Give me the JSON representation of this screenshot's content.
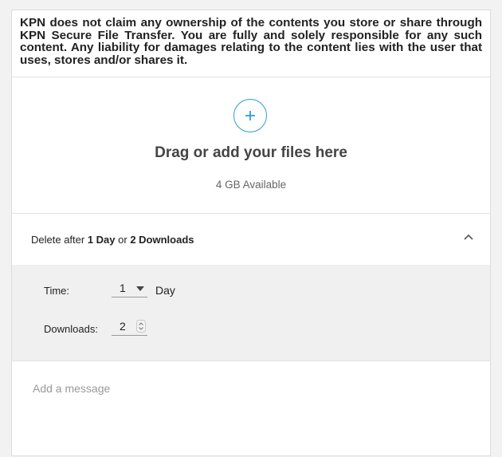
{
  "disclaimer": "KPN does not claim any ownership of the contents you store or share through KPN Secure File Transfer. You are fully and solely responsible for any such content. Any liability for damages relating to the content lies with the user that uses, stores and/or shares it.",
  "upload": {
    "add_icon": "plus-icon",
    "title": "Drag or add your files here",
    "available": "4 GB Available"
  },
  "expiry": {
    "prefix": "Delete after ",
    "days": "1 Day",
    "or": " or ",
    "downloads": "2 Downloads",
    "toggle_icon": "chevron-up-icon"
  },
  "settings": {
    "time_label": "Time:",
    "time_value": "1",
    "time_unit": "Day",
    "downloads_label": "Downloads:",
    "downloads_value": "2"
  },
  "message": {
    "placeholder": "Add a message"
  },
  "colors": {
    "accent": "#2c9fd9",
    "panel": "#f0f0f0"
  }
}
